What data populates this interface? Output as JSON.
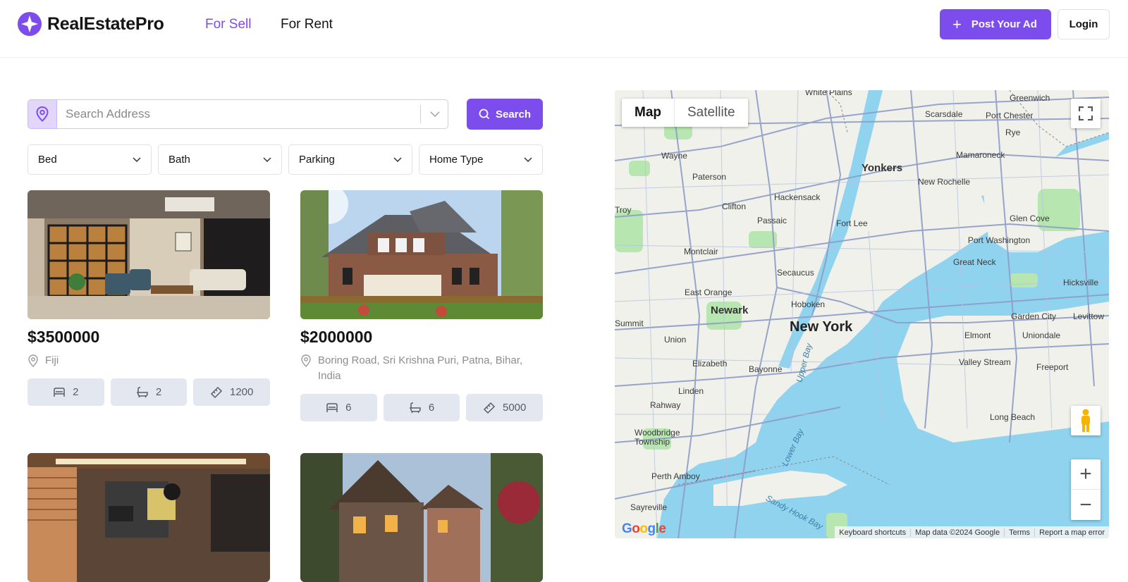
{
  "header": {
    "brand": "RealEstatePro",
    "nav": [
      {
        "label": "For Sell",
        "active": true
      },
      {
        "label": "For Rent",
        "active": false
      }
    ],
    "post_ad_label": "Post Your Ad",
    "login_label": "Login"
  },
  "search": {
    "placeholder": "Search Address",
    "button_label": "Search"
  },
  "filters": [
    {
      "label": "Bed"
    },
    {
      "label": "Bath"
    },
    {
      "label": "Parking"
    },
    {
      "label": "Home Type"
    }
  ],
  "listings": [
    {
      "price": "$3500000",
      "address": "Fiji",
      "beds": "2",
      "baths": "2",
      "area": "1200"
    },
    {
      "price": "$2000000",
      "address": "Boring Road, Sri Krishna Puri, Patna, Bihar, India",
      "beds": "6",
      "baths": "6",
      "area": "5000"
    },
    {
      "price": "",
      "address": "",
      "beds": "",
      "baths": "",
      "area": ""
    },
    {
      "price": "",
      "address": "",
      "beds": "",
      "baths": "",
      "area": ""
    }
  ],
  "map": {
    "type_options": [
      "Map",
      "Satellite"
    ],
    "selected_type": "Map",
    "labels": {
      "new_york": "New York",
      "newark": "Newark",
      "yonkers": "Yonkers",
      "hoboken": "Hoboken",
      "secaucus": "Secaucus",
      "paterson": "Paterson",
      "wayne": "Wayne",
      "clifton": "Clifton",
      "passaic": "Passaic",
      "montclair": "Montclair",
      "east_orange": "East Orange",
      "hackensack": "Hackensack",
      "fort_lee": "Fort Lee",
      "elizabeth": "Elizabeth",
      "bayonne": "Bayonne",
      "linden": "Linden",
      "rahway": "Rahway",
      "union": "Union",
      "summit": "Summit",
      "woodbridge": "Woodbridge Township",
      "perth_amboy": "Perth Amboy",
      "sayreville": "Sayreville",
      "white_plains": "White Plains",
      "greenwich": "Greenwich",
      "scarsdale": "Scarsdale",
      "port_chester": "Port Chester",
      "rye": "Rye",
      "mamaroneck": "Mamaroneck",
      "new_rochelle": "New Rochelle",
      "glen_cove": "Glen Cove",
      "port_washington": "Port Washington",
      "great_neck": "Great Neck",
      "hicksville": "Hicksville",
      "garden_city": "Garden City",
      "levittown": "Levittow",
      "elmont": "Elmont",
      "uniondale": "Uniondale",
      "valley_stream": "Valley Stream",
      "freeport": "Freeport",
      "long_beach": "Long Beach",
      "troy": "Troy",
      "upper_bay": "Upper Bay",
      "lower_bay": "Lower Bay",
      "sandy_hook": "Sandy Hook Bay"
    },
    "footer": [
      "Keyboard shortcuts",
      "Map data ©2024 Google",
      "Terms",
      "Report a map error"
    ],
    "google_logo": "Google"
  },
  "colors": {
    "accent": "#7c4dec",
    "chip_bg": "#e3e8f0",
    "water": "#8fd3ef"
  }
}
